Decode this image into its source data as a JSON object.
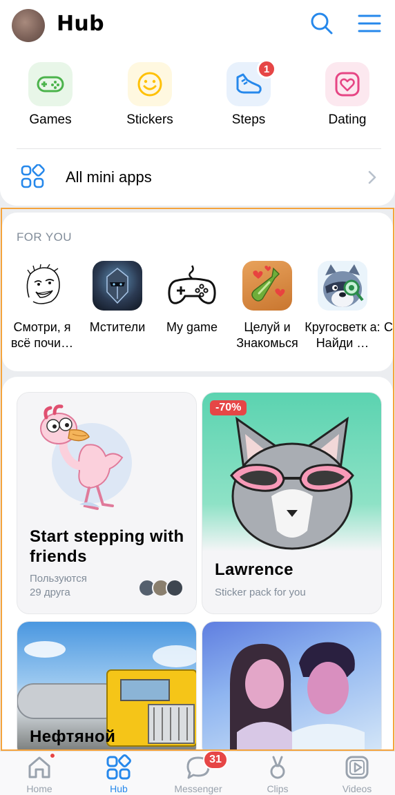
{
  "header": {
    "title": "Hub",
    "avatar_icon": "user-avatar",
    "search_icon": "search-icon",
    "menu_icon": "menu-icon"
  },
  "shortcuts": [
    {
      "label": "Games",
      "icon": "gamepad-icon",
      "color": "#4bb34b"
    },
    {
      "label": "Stickers",
      "icon": "smile-icon",
      "color": "#ffc107"
    },
    {
      "label": "Steps",
      "icon": "sneaker-icon",
      "color": "#2688eb",
      "badge": "1"
    },
    {
      "label": "Dating",
      "icon": "heart-icon",
      "color": "#e64684"
    }
  ],
  "all_apps": {
    "label": "All mini apps",
    "icon": "apps-grid-icon"
  },
  "for_you": {
    "title": "FOR YOU",
    "apps": [
      {
        "name": "Смотри, я всё почи…"
      },
      {
        "name": "Мстители"
      },
      {
        "name": "My game"
      },
      {
        "name": "Целуй и Знакомься"
      },
      {
        "name": "Кругосветк а: Найди …"
      },
      {
        "name": "Со а"
      }
    ]
  },
  "promos": {
    "steps": {
      "title": "Start stepping with friends",
      "sub_line1": "Пользуются",
      "sub_line2": "29 друга"
    },
    "lawrence": {
      "badge": "-70%",
      "title": "Lawrence",
      "sub": "Sticker pack for you"
    },
    "truck": {
      "title": "Нефтяной"
    },
    "couple": {
      "title": ""
    }
  },
  "tabbar": [
    {
      "label": "Home",
      "icon": "home-icon",
      "active": false,
      "dot": true
    },
    {
      "label": "Hub",
      "icon": "hub-icon",
      "active": true
    },
    {
      "label": "Messenger",
      "icon": "chat-icon",
      "active": false,
      "badge": "31"
    },
    {
      "label": "Clips",
      "icon": "clips-icon",
      "active": false
    },
    {
      "label": "Videos",
      "icon": "video-icon",
      "active": false
    }
  ],
  "colors": {
    "accent": "#2688eb",
    "badge": "#e64646",
    "frame": "#f5a33b",
    "muted": "#818c99"
  }
}
